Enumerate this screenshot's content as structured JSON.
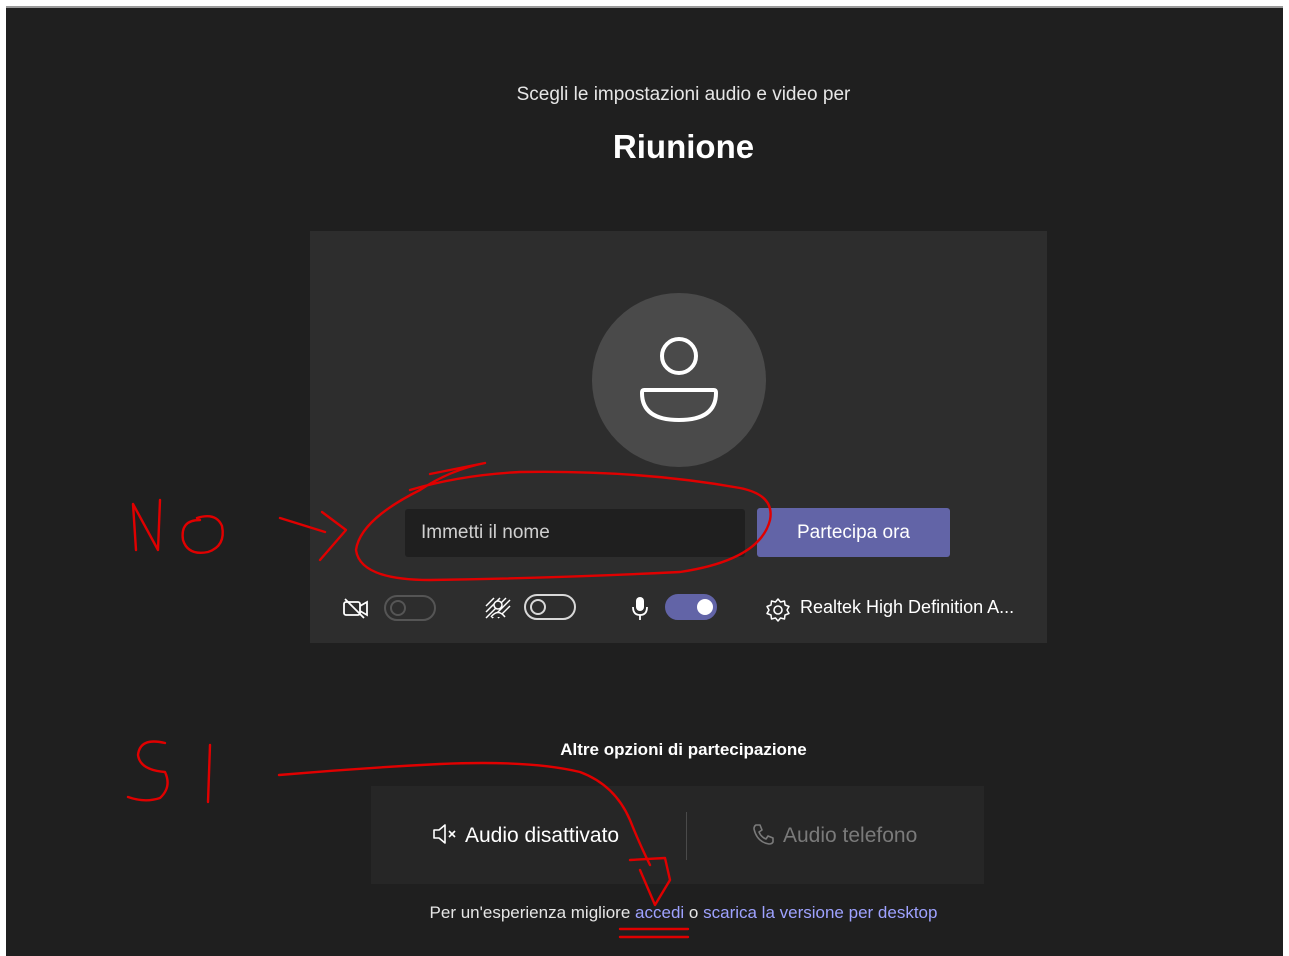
{
  "header": {
    "subtitle": "Scegli le impostazioni audio e video per",
    "meeting_title": "Riunione"
  },
  "prejoin": {
    "name_placeholder": "Immetti il nome",
    "join_label": "Partecipa ora",
    "camera_on": false,
    "background_blur_on": false,
    "microphone_on": true,
    "audio_device": "Realtek High Definition A..."
  },
  "more_options": {
    "label": "Altre opzioni di partecipazione",
    "audio_off": "Audio disattivato",
    "phone_audio": "Audio telefono"
  },
  "footer": {
    "prefix": "Per un'esperienza migliore",
    "signin_link": "accedi",
    "connector": "o",
    "download_link": "scarica la versione per desktop"
  },
  "annotations": {
    "no_text": "NO",
    "si_text": "SI",
    "color": "#e00000"
  },
  "colors": {
    "background": "#1f1f1f",
    "panel": "#2d2d2d",
    "accent": "#6264a7",
    "link": "#9ea2ff"
  }
}
